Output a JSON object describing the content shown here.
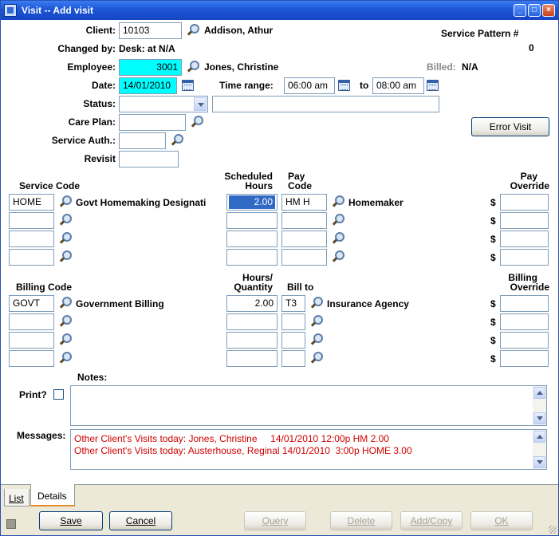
{
  "window": {
    "title": "Visit  -- Add visit"
  },
  "client": {
    "label": "Client:",
    "id": "10103",
    "name": "Addison, Athur"
  },
  "service_pattern": {
    "label": "Service Pattern #",
    "value": "0"
  },
  "changed_by": {
    "label": "Changed by:",
    "value": "Desk: at N/A"
  },
  "employee": {
    "label": "Employee:",
    "id": "3001",
    "name": "Jones, Christine"
  },
  "billed": {
    "label": "Billed:",
    "value": "N/A"
  },
  "date": {
    "label": "Date:",
    "value": "14/01/2010"
  },
  "time_range": {
    "label": "Time range:",
    "from": "06:00 am",
    "to_label": "to",
    "to": "08:00 am"
  },
  "status": {
    "label": "Status:",
    "value": "",
    "text": ""
  },
  "care_plan": {
    "label": "Care Plan:",
    "value": ""
  },
  "service_auth": {
    "label": "Service Auth.:",
    "value": ""
  },
  "revisit": {
    "label": "Revisit",
    "value": ""
  },
  "error_visit_label": "Error Visit",
  "service": {
    "headers": {
      "code": "Service Code",
      "hours_line1": "Scheduled",
      "hours_line2": "Hours",
      "pay_line1": "Pay",
      "pay_line2": "Code",
      "override_line1": "Pay",
      "override_line2": "Override"
    },
    "rows": [
      {
        "code": "HOME",
        "desc": "Govt Homemaking Designati",
        "hours": "2.00",
        "pay_code": "HM  H",
        "pay_desc": "Homemaker",
        "override": ""
      },
      {
        "code": "",
        "desc": "",
        "hours": "",
        "pay_code": "",
        "pay_desc": "",
        "override": ""
      },
      {
        "code": "",
        "desc": "",
        "hours": "",
        "pay_code": "",
        "pay_desc": "",
        "override": ""
      },
      {
        "code": "",
        "desc": "",
        "hours": "",
        "pay_code": "",
        "pay_desc": "",
        "override": ""
      }
    ]
  },
  "billing": {
    "headers": {
      "code": "Billing Code",
      "qty_line1": "Hours/",
      "qty_line2": "Quantity",
      "billto": "Bill to",
      "override_line1": "Billing",
      "override_line2": "Override"
    },
    "rows": [
      {
        "code": "GOVT",
        "desc": "Government Billing",
        "qty": "2.00",
        "bill_to": "T3",
        "bill_desc": "Insurance Agency",
        "override": ""
      },
      {
        "code": "",
        "desc": "",
        "qty": "",
        "bill_to": "",
        "bill_desc": "",
        "override": ""
      },
      {
        "code": "",
        "desc": "",
        "qty": "",
        "bill_to": "",
        "bill_desc": "",
        "override": ""
      },
      {
        "code": "",
        "desc": "",
        "qty": "",
        "bill_to": "",
        "bill_desc": "",
        "override": ""
      }
    ]
  },
  "currency_symbol": "$",
  "notes_label": "Notes:",
  "print_label": "Print?",
  "messages": {
    "label": "Messages:",
    "lines": [
      "Other Client's Visits today: Jones, Christine     14/01/2010 12:00p HM 2.00",
      "Other Client's Visits today: Austerhouse, Reginal 14/01/2010  3:00p HOME 3.00"
    ]
  },
  "tabs": {
    "list": "List",
    "details": "Details"
  },
  "buttons": {
    "save": "Save",
    "cancel": "Cancel",
    "query": "Query",
    "delete": "Delete",
    "addcopy": "Add/Copy",
    "ok": "OK"
  }
}
